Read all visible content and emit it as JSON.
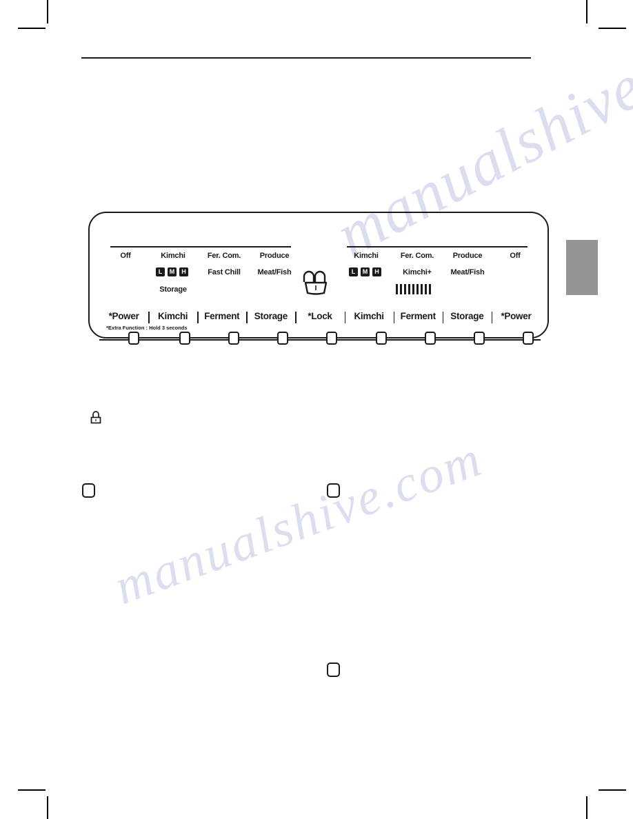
{
  "document": {
    "type": "appliance-manual-page",
    "figure_caption": ""
  },
  "panel": {
    "name": "kimchi-refrigerator-control-panel",
    "left_display": {
      "row1": [
        "Off",
        "Kimchi",
        "Fer. Com.",
        "Produce"
      ],
      "row2_chips": [
        "L",
        "M",
        "H"
      ],
      "row2": [
        "Fast Chill",
        "Meat/Fish"
      ],
      "row3": [
        "Storage"
      ]
    },
    "lock_indicator": {
      "icon": "padlock-icon",
      "label": ""
    },
    "right_display": {
      "row1": [
        "Kimchi",
        "Fer. Com.",
        "Produce",
        "Off"
      ],
      "row2_chips": [
        "L",
        "M",
        "H"
      ],
      "row2": [
        "Kimchi+",
        "Meat/Fish"
      ],
      "bargraph_segments": 9
    },
    "buttons": [
      {
        "label": "*Power",
        "name": "power-button-left"
      },
      {
        "label": "Kimchi",
        "name": "kimchi-button-left"
      },
      {
        "label": "Ferment",
        "name": "ferment-button-left"
      },
      {
        "label": "Storage",
        "name": "storage-button-left"
      },
      {
        "label": "*Lock",
        "name": "lock-button"
      },
      {
        "label": "Kimchi",
        "name": "kimchi-button-right"
      },
      {
        "label": "Ferment",
        "name": "ferment-button-right"
      },
      {
        "label": "Storage",
        "name": "storage-button-right"
      },
      {
        "label": "*Power",
        "name": "power-button-right"
      }
    ],
    "footnote": "*Extra Function : Hold 3 seconds"
  },
  "callouts": {
    "lock_icon": "padlock-icon",
    "button_outline": "button-outline-icon"
  },
  "watermark": {
    "line1": "manualshive.com",
    "line2": "manualshive.com"
  },
  "colors": {
    "ink": "#1a1a1a",
    "page_tab": "#949494",
    "watermark": "#c9c9e8"
  }
}
